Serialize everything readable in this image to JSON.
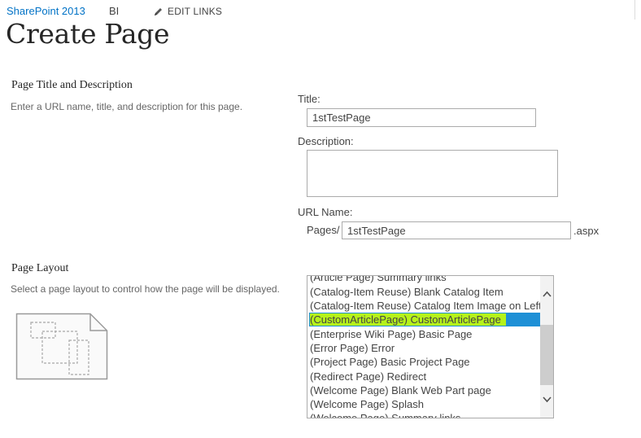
{
  "topnav": {
    "site_title": "SharePoint 2013",
    "bi_link": "BI",
    "edit_links": "EDIT LINKS",
    "edit_icon": "pencil-icon"
  },
  "page_title": "Create Page",
  "title_section": {
    "heading": "Page Title and Description",
    "description": "Enter a URL name, title, and description for this page."
  },
  "fields": {
    "title_label": "Title:",
    "title_value": "1stTestPage",
    "description_label": "Description:",
    "description_value": "",
    "url_label": "URL Name:",
    "url_prefix": "Pages/",
    "url_value": "1stTestPage",
    "url_suffix": ".aspx"
  },
  "layout_section": {
    "heading": "Page Layout",
    "description": "Select a page layout to control how the page will be displayed.",
    "preview_icon": "page-layout-preview-icon"
  },
  "layout_options": [
    "(Article Page) Summary links",
    "(Catalog-Item Reuse) Blank Catalog Item",
    "(Catalog-Item Reuse) Catalog Item Image on Left",
    "(CustomArticlePage) CustomArticlePage",
    "(Enterprise Wiki Page) Basic Page",
    "(Error Page) Error",
    "(Project Page) Basic Project Page",
    "(Redirect Page) Redirect",
    "(Welcome Page) Blank Web Part page",
    "(Welcome Page) Splash",
    "(Welcome Page) Summary links"
  ],
  "selected_layout": "(CustomArticlePage) CustomArticlePage",
  "colors": {
    "link": "#0072c6",
    "selection": "#1e90d6",
    "highlight": "#b5f21b"
  }
}
